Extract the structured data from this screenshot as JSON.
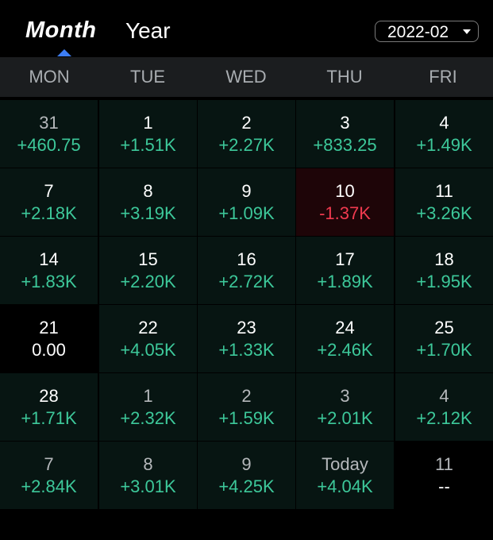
{
  "tabs": {
    "month": "Month",
    "year": "Year",
    "active": "Month"
  },
  "month_select": {
    "value": "2022-02"
  },
  "weekdays": [
    "MON",
    "TUE",
    "WED",
    "THU",
    "FRI"
  ],
  "colors": {
    "positive": "#3dc89a",
    "negative": "#f03a4f",
    "accent": "#3d7ef5"
  },
  "calendar": [
    [
      {
        "day": "31",
        "value": "+460.75",
        "status": "positive",
        "outside": true
      },
      {
        "day": "1",
        "value": "+1.51K",
        "status": "positive"
      },
      {
        "day": "2",
        "value": "+2.27K",
        "status": "positive"
      },
      {
        "day": "3",
        "value": "+833.25",
        "status": "positive"
      },
      {
        "day": "4",
        "value": "+1.49K",
        "status": "positive"
      }
    ],
    [
      {
        "day": "7",
        "value": "+2.18K",
        "status": "positive"
      },
      {
        "day": "8",
        "value": "+3.19K",
        "status": "positive"
      },
      {
        "day": "9",
        "value": "+1.09K",
        "status": "positive"
      },
      {
        "day": "10",
        "value": "-1.37K",
        "status": "negative"
      },
      {
        "day": "11",
        "value": "+3.26K",
        "status": "positive"
      }
    ],
    [
      {
        "day": "14",
        "value": "+1.83K",
        "status": "positive"
      },
      {
        "day": "15",
        "value": "+2.20K",
        "status": "positive"
      },
      {
        "day": "16",
        "value": "+2.72K",
        "status": "positive"
      },
      {
        "day": "17",
        "value": "+1.89K",
        "status": "positive"
      },
      {
        "day": "18",
        "value": "+1.95K",
        "status": "positive"
      }
    ],
    [
      {
        "day": "21",
        "value": "0.00",
        "status": "zero"
      },
      {
        "day": "22",
        "value": "+4.05K",
        "status": "positive"
      },
      {
        "day": "23",
        "value": "+1.33K",
        "status": "positive"
      },
      {
        "day": "24",
        "value": "+2.46K",
        "status": "positive"
      },
      {
        "day": "25",
        "value": "+1.70K",
        "status": "positive"
      }
    ],
    [
      {
        "day": "28",
        "value": "+1.71K",
        "status": "positive"
      },
      {
        "day": "1",
        "value": "+2.32K",
        "status": "positive",
        "outside": true
      },
      {
        "day": "2",
        "value": "+1.59K",
        "status": "positive",
        "outside": true
      },
      {
        "day": "3",
        "value": "+2.01K",
        "status": "positive",
        "outside": true
      },
      {
        "day": "4",
        "value": "+2.12K",
        "status": "positive",
        "outside": true
      }
    ],
    [
      {
        "day": "7",
        "value": "+2.84K",
        "status": "positive",
        "outside": true
      },
      {
        "day": "8",
        "value": "+3.01K",
        "status": "positive",
        "outside": true
      },
      {
        "day": "9",
        "value": "+4.25K",
        "status": "positive",
        "outside": true
      },
      {
        "day": "Today",
        "value": "+4.04K",
        "status": "positive",
        "outside": true
      },
      {
        "day": "11",
        "value": "--",
        "status": "zero",
        "outside": true
      }
    ]
  ]
}
